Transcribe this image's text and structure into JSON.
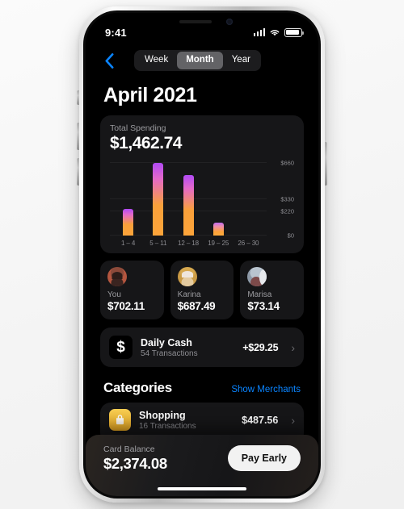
{
  "status_bar": {
    "time": "9:41",
    "signal_icon": "cellular-signal-icon",
    "wifi_icon": "wifi-icon",
    "battery_icon": "battery-icon"
  },
  "nav": {
    "back_icon": "chevron-left-icon",
    "segments": [
      {
        "label": "Week",
        "active": false
      },
      {
        "label": "Month",
        "active": true
      },
      {
        "label": "Year",
        "active": false
      }
    ]
  },
  "page_title": "April 2021",
  "spending_card": {
    "label": "Total Spending",
    "total": "$1,462.74"
  },
  "chart_data": {
    "type": "bar",
    "title": "Total Spending",
    "categories": [
      "1 – 4",
      "5 – 11",
      "12 – 18",
      "19 – 25",
      "26 – 30"
    ],
    "values": [
      240,
      660,
      550,
      120,
      0
    ],
    "ytick_labels": [
      "$660",
      "$330",
      "$220",
      "$0"
    ],
    "ytick_values": [
      660,
      330,
      220,
      0
    ],
    "ylim": [
      0,
      700
    ],
    "xlabel": "",
    "ylabel": "",
    "grid": true,
    "legend": "none",
    "bar_gradient_top": "#b14af5",
    "bar_gradient_mid": "#e469c8",
    "bar_gradient_bottom": "#fca43a"
  },
  "people": [
    {
      "name": "You",
      "amount": "$702.11",
      "avatar": "avatar-you"
    },
    {
      "name": "Karina",
      "amount": "$687.49",
      "avatar": "avatar-karina"
    },
    {
      "name": "Marisa",
      "amount": "$73.14",
      "avatar": "avatar-marisa"
    }
  ],
  "daily_cash": {
    "icon": "dollar-sign-icon",
    "icon_glyph": "$",
    "title": "Daily Cash",
    "subtitle": "54 Transactions",
    "amount": "+$29.25",
    "chevron": "›"
  },
  "categories": {
    "heading": "Categories",
    "link_label": "Show Merchants",
    "rows": [
      {
        "icon": "shopping-bag-icon",
        "name": "Shopping",
        "subtitle": "16 Transactions",
        "amount": "$487.56",
        "chevron": "›"
      }
    ]
  },
  "balance_bar": {
    "label": "Card Balance",
    "amount": "$2,374.08",
    "button_label": "Pay Early"
  },
  "colors": {
    "accent_blue": "#0a84ff",
    "screen_bg": "#000000",
    "card_bg": "#161618",
    "segment_active": "#636366",
    "muted_text": "#8e8e93"
  }
}
